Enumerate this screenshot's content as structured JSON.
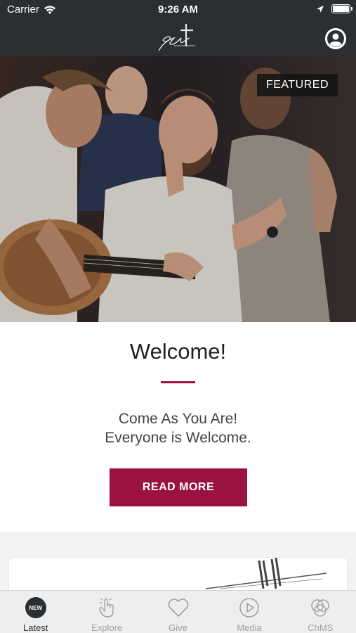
{
  "status_bar": {
    "carrier": "Carrier",
    "time": "9:26 AM"
  },
  "nav": {
    "logo_icon": "grace-church-logo",
    "profile_icon": "user-profile-icon"
  },
  "hero": {
    "badge": "FEATURED"
  },
  "card": {
    "title": "Welcome!",
    "subtitle_line1": "Come As You Are!",
    "subtitle_line2": "Everyone is Welcome.",
    "button": "READ MORE"
  },
  "tabs": [
    {
      "label": "Latest",
      "badge": "NEW",
      "icon": "new-badge-icon",
      "active": true
    },
    {
      "label": "Explore",
      "icon": "tap-hand-icon",
      "active": false
    },
    {
      "label": "Give",
      "icon": "heart-icon",
      "active": false
    },
    {
      "label": "Media",
      "icon": "play-circle-icon",
      "active": false
    },
    {
      "label": "ChMS",
      "icon": "circles-icon",
      "active": false
    }
  ],
  "colors": {
    "accent": "#9a1240",
    "bar": "#2b2f33"
  }
}
